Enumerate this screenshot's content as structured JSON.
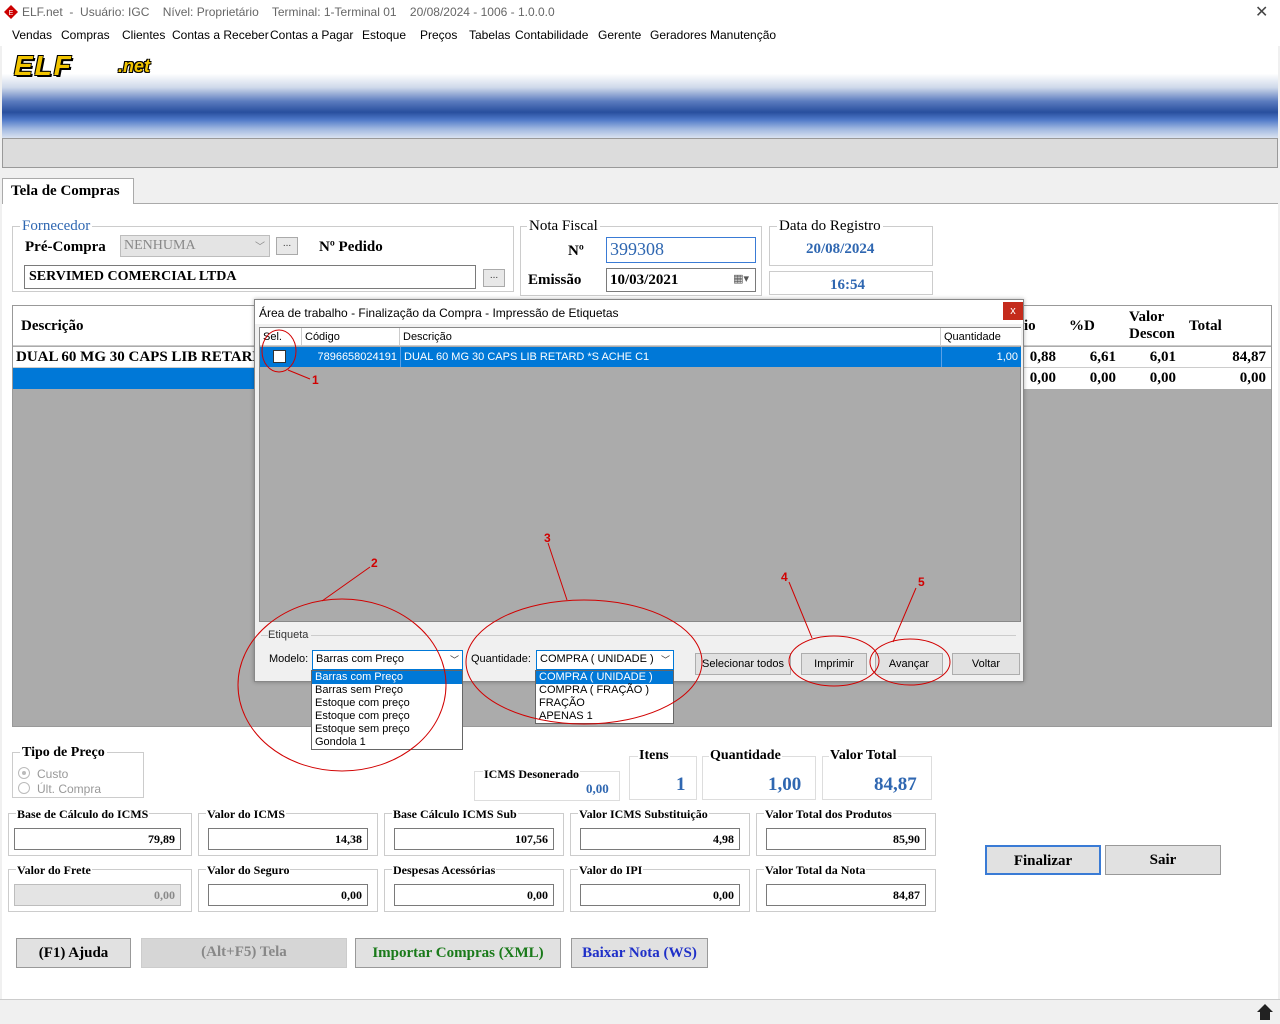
{
  "window": {
    "title_text": "ELF.net  -  Usuário: IGC    Nível: Proprietário    Terminal: 1-Terminal 01    20/08/2024 - 1006 - 1.0.0.0",
    "close_glyph": "✕"
  },
  "menu": [
    "Vendas",
    "Compras",
    "Clientes",
    "Contas a Receber",
    "Contas a Pagar",
    "Estoque",
    "Preços",
    "Tabelas",
    "Contabilidade",
    "Gerente",
    "Geradores",
    "Manutenção"
  ],
  "banner": {
    "logo_main": "ELF",
    "logo_sub": ".net"
  },
  "tab": {
    "label": "Tela de Compras"
  },
  "fornecedor": {
    "group_label": "Fornecedor",
    "pre_compra_label": "Pré-Compra",
    "pre_compra_value": "NENHUMA",
    "pedido_label": "Nº Pedido",
    "supplier_name": "SERVIMED COMERCIAL LTDA",
    "ellipsis": "..."
  },
  "nota_fiscal": {
    "group_label": "Nota Fiscal",
    "numero_label": "Nº",
    "numero_value": "399308",
    "emissao_label": "Emissão",
    "emissao_value": "10/03/2021"
  },
  "registro": {
    "group_label": "Data do Registro",
    "date": "20/08/2024",
    "time": "16:54"
  },
  "grid": {
    "col_descricao": "Descrição",
    "col_io": "io",
    "col_pd": "%D",
    "col_valor": "Valor",
    "col_descon": "Descon",
    "col_total": "Total",
    "rows": [
      {
        "descricao": "DUAL 60 MG 30 CAPS LIB RETARD *",
        "io": "0,88",
        "pd": "6,61",
        "valor": "6,01",
        "total": "84,87"
      },
      {
        "descricao": "",
        "io": "0,00",
        "pd": "0,00",
        "valor": "0,00",
        "total": "0,00"
      }
    ]
  },
  "modal": {
    "title": "Área de trabalho - Finalização da Compra - Impressão de Etiquetas",
    "close": "x",
    "headers": {
      "sel": "Sel.",
      "codigo": "Código",
      "descricao": "Descrição",
      "quantidade": "Quantidade"
    },
    "row": {
      "codigo": "7896658024191",
      "descricao": "DUAL 60 MG 30 CAPS LIB RETARD *S ACHE C1",
      "quantidade": "1,00"
    },
    "etiqueta_label": "Etiqueta",
    "modelo_label": "Modelo:",
    "modelo_value": "Barras com Preço",
    "modelo_options": [
      "Barras com Preço",
      "Barras sem Preço",
      "Estoque com  preço",
      "Estoque com  preço",
      "Estoque sem preço",
      "Gondola 1"
    ],
    "quantidade_label": "Quantidade:",
    "quantidade_value": "COMPRA ( UNIDADE )",
    "quantidade_options": [
      "COMPRA ( UNIDADE )",
      "COMPRA ( FRAÇÃO )",
      "FRAÇÃO",
      "APENAS 1"
    ],
    "btn_selecionar": "Selecionar todos",
    "btn_imprimir": "Imprimir",
    "btn_avancar": "Avançar",
    "btn_voltar": "Voltar"
  },
  "annotations": [
    "1",
    "2",
    "3",
    "4",
    "5"
  ],
  "tipo_preco": {
    "label": "Tipo de Preço",
    "opt1": "Custo",
    "opt2": "Últ. Compra"
  },
  "icms_desonerado": {
    "label": "ICMS Desonerado",
    "value": "0,00"
  },
  "totals": {
    "itens_label": "Itens",
    "itens_value": "1",
    "quantidade_label": "Quantidade",
    "quantidade_value": "1,00",
    "valor_total_label": "Valor Total",
    "valor_total_value": "84,87"
  },
  "fields": [
    {
      "label": "Base de Cálculo do ICMS",
      "value": "79,89"
    },
    {
      "label": "Valor do ICMS",
      "value": "14,38"
    },
    {
      "label": "Base Cálculo ICMS Sub",
      "value": "107,56"
    },
    {
      "label": "Valor ICMS Substituição",
      "value": "4,98"
    },
    {
      "label": "Valor Total dos Produtos",
      "value": "85,90"
    },
    {
      "label": "Valor do Frete",
      "value": "0,00"
    },
    {
      "label": "Valor do Seguro",
      "value": "0,00"
    },
    {
      "label": "Despesas Acessórias",
      "value": "0,00"
    },
    {
      "label": "Valor do IPI",
      "value": "0,00"
    },
    {
      "label": "Valor Total da Nota",
      "value": "84,87"
    }
  ],
  "buttons": {
    "finalizar": "Finalizar",
    "sair": "Sair",
    "ajuda": "(F1) Ajuda",
    "tela": "(Alt+F5) Tela",
    "importar": "Importar Compras (XML)",
    "baixar": "Baixar Nota (WS)"
  },
  "colors": {
    "accent_blue": "#2f67b1",
    "selection": "#0078d7",
    "annotation_red": "#d10000"
  }
}
